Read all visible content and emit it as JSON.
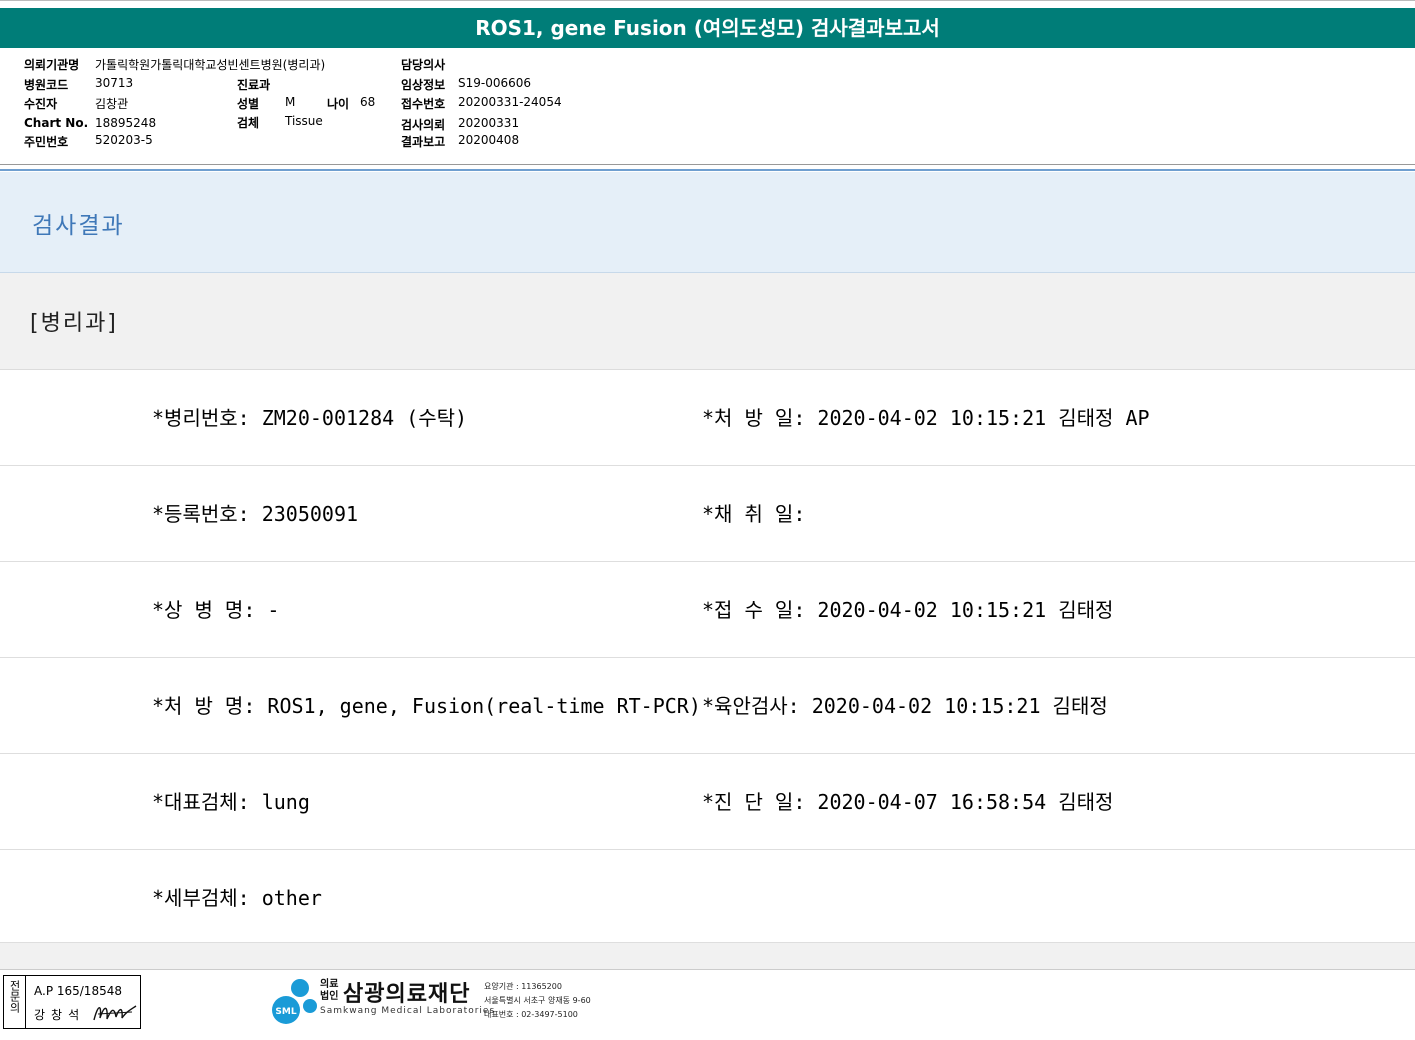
{
  "title": "ROS1, gene Fusion (여의도성모) 검사결과보고서",
  "header": {
    "institution_label": "의뢰기관명",
    "institution": "가톨릭학원가톨릭대학교성빈센트병원(병리과)",
    "hospital_code_label": "병원코드",
    "hospital_code": "30713",
    "patient_label": "수진자",
    "patient": "김창관",
    "chart_label": "Chart No.",
    "chart": "18895248",
    "resident_label": "주민번호",
    "resident": "520203-5",
    "dept_label": "진료과",
    "dept": "",
    "sex_label": "성별",
    "sex": "M",
    "age_label": "나이",
    "age": "68",
    "specimen_label": "검체",
    "specimen": "Tissue",
    "doctor_label": "담당의사",
    "doctor": "",
    "clinical_label": "임상정보",
    "clinical": "S19-006606",
    "receipt_label": "접수번호",
    "receipt": "20200331-24054",
    "request_label": "검사의뢰",
    "request": "20200331",
    "report_label": "결과보고",
    "report": "20200408"
  },
  "section_title": "검사결과",
  "dept_title": "[병리과]",
  "rows": [
    {
      "l": "*병리번호: ZM20-001284 (수탁)",
      "r": "*처 방 일: 2020-04-02 10:15:21  김태정 AP"
    },
    {
      "l": "*등록번호: 23050091",
      "r": "*채 취 일:"
    },
    {
      "l": "*상 병 명: -",
      "r": "*접 수 일: 2020-04-02 10:15:21  김태정"
    },
    {
      "l": "*처 방 명: ROS1, gene, Fusion(real-time RT-PCR)",
      "r": "*육안검사: 2020-04-02 10:15:21  김태정"
    },
    {
      "l": "*대표검체: lung",
      "r": "*진 단 일: 2020-04-07 16:58:54  김태정"
    },
    {
      "l": "*세부검체: other",
      "r": ""
    }
  ],
  "footer": {
    "stamp_vertical": "전문의",
    "stamp_id": "A.P 165/18548",
    "stamp_name": "강창석",
    "logo_small_1": "의료",
    "logo_small_2": "법인",
    "logo_name": "삼광의료재단",
    "logo_sml": "SML",
    "logo_en": "Samkwang Medical Laboratories",
    "info_1": "요양기관 : 11365200",
    "info_2": "서울특별시 서초구 양재동 9-60",
    "info_3": "대표번호 : 02-3497-5100"
  },
  "colors": {
    "title_bar": "#007d78",
    "section_bg": "#e5eff8",
    "section_text": "#3f78b8",
    "dept_bg": "#f1f1f1"
  }
}
